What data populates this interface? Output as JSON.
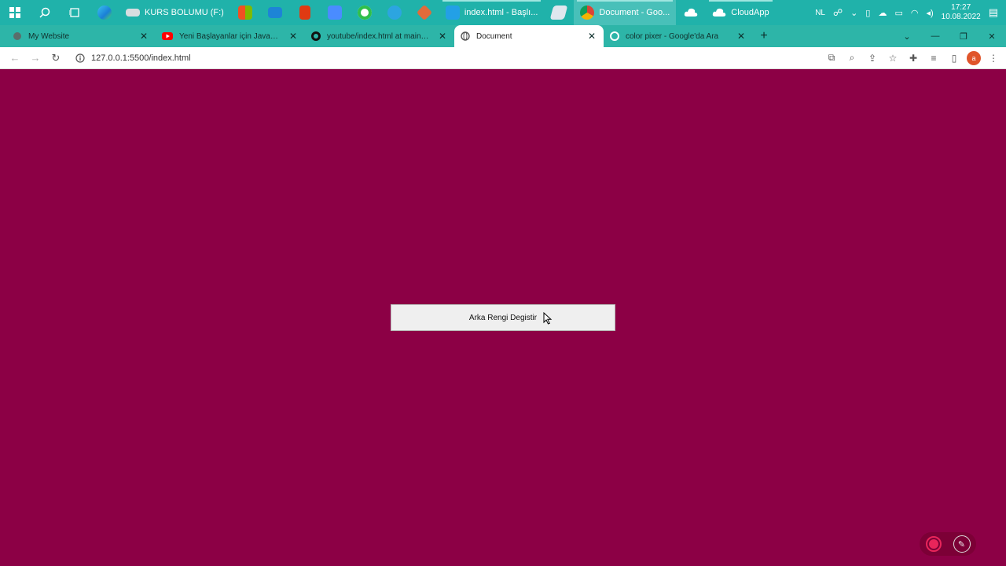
{
  "taskbar": {
    "drive_label": "KURS BOLUMU (F:)",
    "vscode_label": "index.html - Başlı...",
    "chrome_label": "Document - Goo...",
    "cloudapp_label": "CloudApp",
    "lang": "NL",
    "time": "17:27",
    "date": "10.08.2022"
  },
  "tabs": [
    {
      "label": "My Website",
      "icon": "globe-icon"
    },
    {
      "label": "Yeni Başlayanlar için Javascript P",
      "icon": "youtube-icon"
    },
    {
      "label": "youtube/index.html at main · en",
      "icon": "github-icon"
    },
    {
      "label": "Document",
      "icon": "globe-icon",
      "active": true
    },
    {
      "label": "color pixer - Google'da Ara",
      "icon": "google-icon"
    }
  ],
  "toolbar": {
    "url": "127.0.0.1:5500/index.html",
    "avatar_letter": "a"
  },
  "page": {
    "background": "#8c0045",
    "button_label": "Arka Rengi Degistir"
  }
}
